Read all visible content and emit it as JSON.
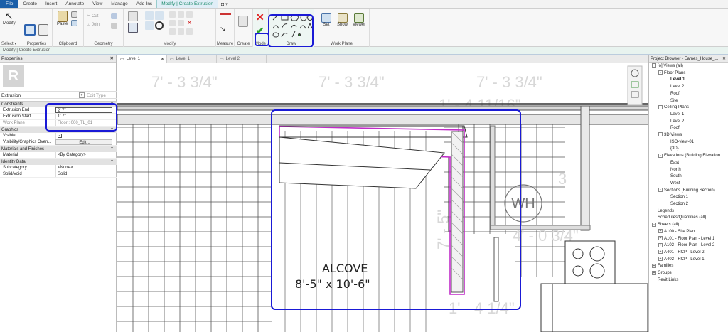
{
  "ribbon": {
    "tabs": [
      "File",
      "Create",
      "Insert",
      "Annotate",
      "View",
      "Manage",
      "Add-Ins",
      "Modify | Create Extrusion"
    ],
    "select_label": "Select",
    "panels": {
      "modify_label": "Modify",
      "properties_label": "Properties",
      "paste_label": "Paste",
      "clipboard_label": "Clipboard",
      "cut_label": "Cut",
      "join_label": "Join",
      "geometry_label": "Geometry",
      "modify_panel_label": "Modify",
      "measure_label": "Measure",
      "create_label": "Create",
      "mode_label": "Mode",
      "draw_label": "Draw",
      "set_label": "Set",
      "show_label": "Show",
      "viewer_label": "Viewer",
      "workplane_label": "Work Plane"
    },
    "context_bar": "Modify | Create Extrusion"
  },
  "properties": {
    "title": "Properties",
    "type_name": "Extrusion",
    "edit_type": "Edit Type",
    "sections": [
      {
        "name": "Constraints",
        "rows": [
          {
            "name": "Extrusion End",
            "value": "2'  7\""
          },
          {
            "name": "Extrusion Start",
            "value": "1'  7\""
          },
          {
            "name": "Work Plane",
            "value": "Floor : 000_TL_01"
          }
        ]
      },
      {
        "name": "Graphics",
        "rows": [
          {
            "name": "Visible",
            "value": "✓"
          },
          {
            "name": "Visibility/Graphics Overr...",
            "value": "Edit..."
          }
        ]
      },
      {
        "name": "Materials and Finishes",
        "rows": [
          {
            "name": "Material",
            "value": "<By Category>"
          }
        ]
      },
      {
        "name": "Identity Data",
        "rows": [
          {
            "name": "Subcategory",
            "value": "<None>"
          },
          {
            "name": "Solid/Void",
            "value": "Solid"
          }
        ]
      }
    ]
  },
  "view_tabs": [
    "Level 1",
    "Level 1",
    "Level 2"
  ],
  "drawing": {
    "dims": [
      "7' - 3 3/4\"",
      "7' - 3 3/4\"",
      "7' - 3 3/4\"",
      "1' - 4 11/16\"",
      "7' - 5\"",
      "4' - 0 3/4\"",
      "1' - 4 1/4\"",
      "WH",
      "3"
    ],
    "alcove_title": "ALCOVE",
    "alcove_size": "8'-5\" x 10'-6\""
  },
  "browser": {
    "title": "Project Browser - Eames_House_...",
    "items": [
      {
        "label": "[o] Views (all)",
        "level": 0,
        "toggle": "-"
      },
      {
        "label": "Floor Plans",
        "level": 1,
        "toggle": "-"
      },
      {
        "label": "Level 1",
        "level": 2,
        "bold": true
      },
      {
        "label": "Level 2",
        "level": 2
      },
      {
        "label": "Roof",
        "level": 2
      },
      {
        "label": "Site",
        "level": 2
      },
      {
        "label": "Ceiling Plans",
        "level": 1,
        "toggle": "-"
      },
      {
        "label": "Level 1",
        "level": 2
      },
      {
        "label": "Level 2",
        "level": 2
      },
      {
        "label": "Roof",
        "level": 2
      },
      {
        "label": "3D Views",
        "level": 1,
        "toggle": "-"
      },
      {
        "label": "ISO-view-01",
        "level": 2
      },
      {
        "label": "{3D}",
        "level": 2
      },
      {
        "label": "Elevations (Building Elevation",
        "level": 1,
        "toggle": "-"
      },
      {
        "label": "East",
        "level": 2
      },
      {
        "label": "North",
        "level": 2
      },
      {
        "label": "South",
        "level": 2
      },
      {
        "label": "West",
        "level": 2
      },
      {
        "label": "Sections (Building Section)",
        "level": 1,
        "toggle": "-"
      },
      {
        "label": "Section 1",
        "level": 2
      },
      {
        "label": "Section 2",
        "level": 2
      },
      {
        "label": "Legends",
        "level": 0
      },
      {
        "label": "Schedules/Quantities (all)",
        "level": 0
      },
      {
        "label": "Sheets (all)",
        "level": 0,
        "toggle": "-"
      },
      {
        "label": "A100 - Site Plan",
        "level": 1,
        "toggle": "+"
      },
      {
        "label": "A101 - Floor Plan - Level 1",
        "level": 1,
        "toggle": "+"
      },
      {
        "label": "A102 - Floor Plan - Level 2",
        "level": 1,
        "toggle": "+"
      },
      {
        "label": "A401 - RCP - Level 2",
        "level": 1,
        "toggle": "+"
      },
      {
        "label": "A402 - RCP - Level 1",
        "level": 1,
        "toggle": "+"
      },
      {
        "label": "Families",
        "level": 0,
        "toggle": "+"
      },
      {
        "label": "Groups",
        "level": 0,
        "toggle": "+"
      },
      {
        "label": "Revit Links",
        "level": 0
      }
    ]
  },
  "colors": {
    "highlight": "#1a1ad6",
    "sketch": "#c02cc8",
    "file_tab": "#1a5ea8",
    "context": "#1b8a6b"
  }
}
